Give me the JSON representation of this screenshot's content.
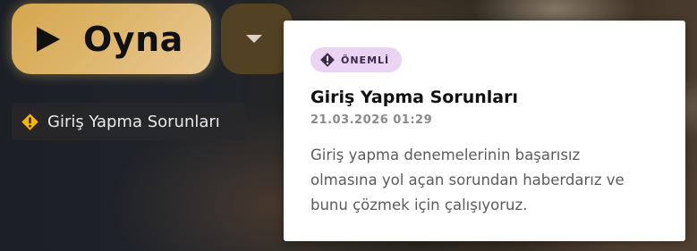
{
  "play_button": {
    "label": "Oyna",
    "icon": "play-icon"
  },
  "dropdown_button": {
    "icon": "chevron-down-icon"
  },
  "status_pill": {
    "icon": "warning-icon",
    "label": "Giriş Yapma Sorunları",
    "icon_color": "#f5b50a"
  },
  "notice_card": {
    "badge": {
      "icon": "alert-diamond-icon",
      "label": "ÖNEMLİ",
      "color": "#ead3f3"
    },
    "title": "Giriş Yapma Sorunları",
    "date": "21.03.2026 01:29",
    "body": "Giriş yapma denemelerinin başarısız olmasına yol açan sorundan haberdarız ve bunu çözmek için çalışıyoruz."
  },
  "colors": {
    "accent_gold": "#d4a64d",
    "card_background": "#ffffff"
  }
}
